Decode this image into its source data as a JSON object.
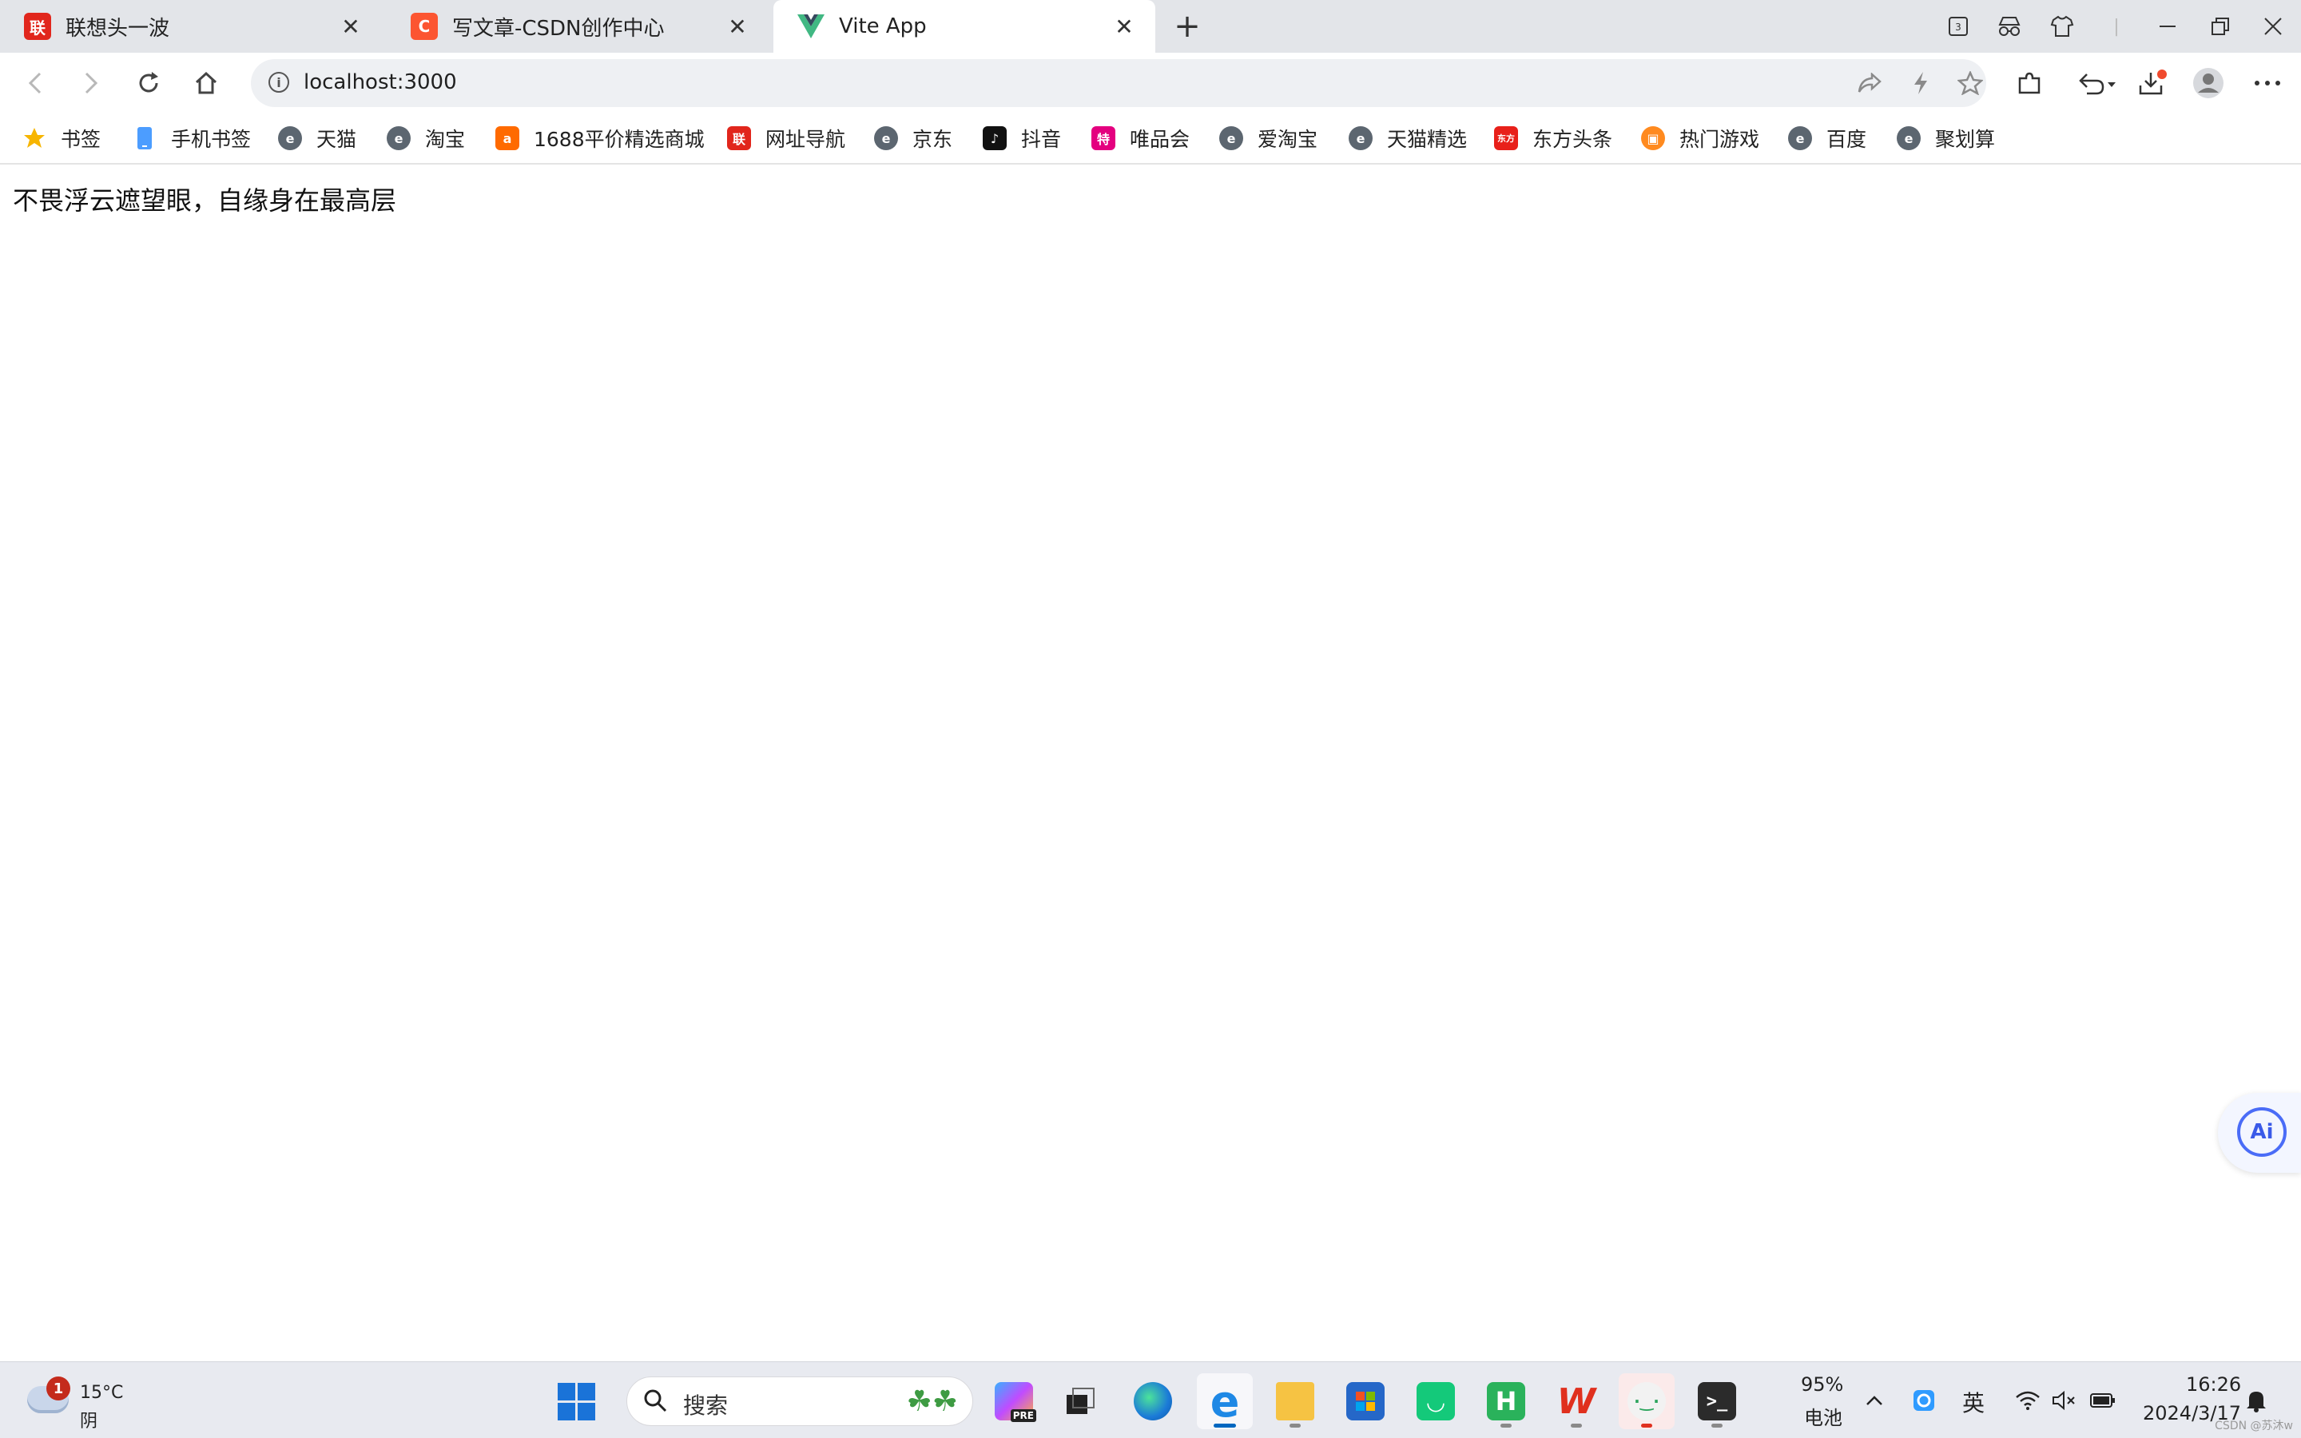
{
  "browser": {
    "tabs": [
      {
        "title": "联想头一波",
        "favicon": "lenovo-icon",
        "color": "#e1261c",
        "active": false
      },
      {
        "title": "写文章-CSDN创作中心",
        "favicon": "csdn-icon",
        "color": "#fc5531",
        "active": false
      },
      {
        "title": "Vite App",
        "favicon": "vue-icon",
        "color": "#41b883",
        "active": true
      }
    ],
    "tab_close_glyph": "✕",
    "new_tab_glyph": "+",
    "address": {
      "url": "localhost:3000"
    }
  },
  "bookmarks": [
    {
      "label": "书签",
      "icon": "star-icon",
      "color": "#f7b500"
    },
    {
      "label": "手机书签",
      "icon": "phone-icon",
      "color": "#4c9dff"
    },
    {
      "label": "天猫",
      "icon": "e-browser-icon",
      "color": "#5c6670"
    },
    {
      "label": "淘宝",
      "icon": "e-browser-icon",
      "color": "#5c6670"
    },
    {
      "label": "1688平价精选商城",
      "icon": "alibaba-1688-icon",
      "color": "#ff6a00"
    },
    {
      "label": "网址导航",
      "icon": "lenovo-nav-icon",
      "color": "#e1261c"
    },
    {
      "label": "京东",
      "icon": "e-browser-icon",
      "color": "#5c6670"
    },
    {
      "label": "抖音",
      "icon": "douyin-icon",
      "color": "#111111"
    },
    {
      "label": "唯品会",
      "icon": "vip-icon",
      "color": "#e4007f"
    },
    {
      "label": "爱淘宝",
      "icon": "e-browser-icon",
      "color": "#5c6670"
    },
    {
      "label": "天猫精选",
      "icon": "e-browser-icon",
      "color": "#5c6670"
    },
    {
      "label": "东方头条",
      "icon": "dongfang-icon",
      "color": "#e8201a"
    },
    {
      "label": "热门游戏",
      "icon": "game-icon",
      "color": "#ff8a1f"
    },
    {
      "label": "百度",
      "icon": "e-browser-icon",
      "color": "#5c6670"
    },
    {
      "label": "聚划算",
      "icon": "e-browser-icon",
      "color": "#5c6670"
    }
  ],
  "page": {
    "text": "不畏浮云遮望眼，自缘身在最高层",
    "ai_label": "Ai"
  },
  "taskbar": {
    "weather": {
      "temp": "15°C",
      "condition": "阴",
      "badge": "1"
    },
    "search_placeholder": "搜索",
    "battery_percent": "95%",
    "battery_label": "电池",
    "ime": "英",
    "time": "16:26",
    "date": "2024/3/17",
    "pre_badge": "PRE",
    "wps_glyph": "W",
    "hbuilder_glyph": "H"
  },
  "watermark": "CSDN @苏沐w"
}
